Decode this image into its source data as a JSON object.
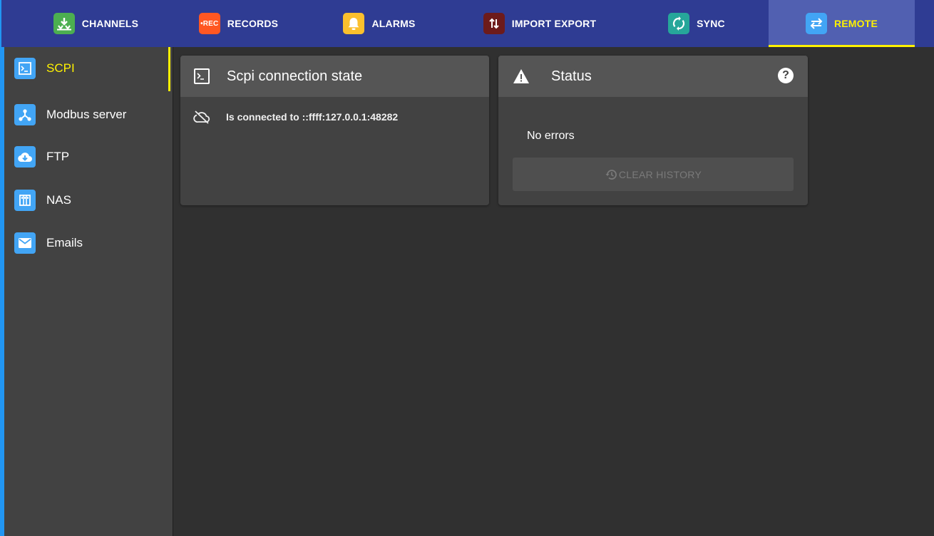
{
  "topnav": {
    "tabs": [
      {
        "label": "CHANNELS",
        "icon": "channels-icon",
        "icon_bg": "#4caf50"
      },
      {
        "label": "RECORDS",
        "icon": "rec-icon",
        "icon_bg": "#ff5722",
        "icon_text": "•REC"
      },
      {
        "label": "ALARMS",
        "icon": "bell-icon",
        "icon_bg": "#fbc02d"
      },
      {
        "label": "IMPORT EXPORT",
        "icon": "import-export-icon",
        "icon_bg": "#6d1b1b"
      },
      {
        "label": "SYNC",
        "icon": "sync-icon",
        "icon_bg": "#26a69a"
      },
      {
        "label": "REMOTE",
        "icon": "remote-arrows-icon",
        "icon_bg": "#42a5f5",
        "active": true
      }
    ]
  },
  "sidebar": {
    "items": [
      {
        "label": "SCPI",
        "icon": "terminal-icon",
        "active": true
      },
      {
        "label": "Modbus server",
        "icon": "network-icon"
      },
      {
        "label": "FTP",
        "icon": "cloud-download-icon"
      },
      {
        "label": "NAS",
        "icon": "nas-icon"
      },
      {
        "label": "Emails",
        "icon": "mail-icon"
      }
    ]
  },
  "scpi_card": {
    "title": "Scpi connection state",
    "connection_text": "Is connected to ::ffff:127.0.0.1:48282"
  },
  "status_card": {
    "title": "Status",
    "message": "No errors",
    "clear_button": "CLEAR HISTORY"
  },
  "colors": {
    "accent_yellow": "#fff200",
    "nav_bg": "#2f3c93",
    "nav_active_bg": "#5160b1",
    "sidebar_bg": "#424242",
    "content_bg": "#303030"
  }
}
